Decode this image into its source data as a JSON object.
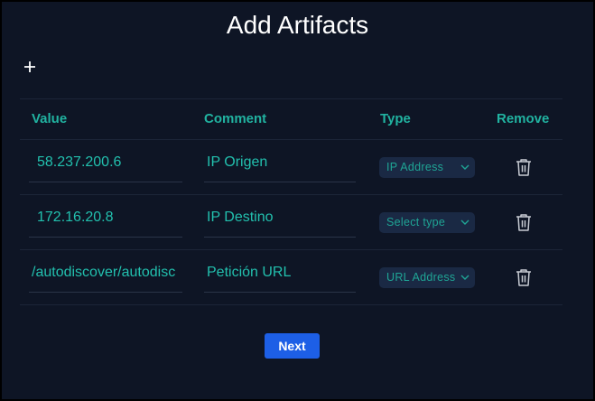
{
  "dialog": {
    "title": "Add Artifacts",
    "add_icon": "plus-icon",
    "next_label": "Next"
  },
  "table": {
    "headers": [
      "Value",
      "Comment",
      "Type",
      "Remove"
    ],
    "rows": [
      {
        "value": "58.237.200.6",
        "comment": "IP Origen",
        "type": "IP Address"
      },
      {
        "value": "172.16.20.8",
        "comment": "IP Destino",
        "type": "Select type"
      },
      {
        "value": "/autodiscover/autodisc",
        "comment": "Petición URL",
        "type": "URL Address"
      }
    ],
    "remove_icon": "trash-icon",
    "select_icon": "chevron-down-icon"
  },
  "colors": {
    "background": "#0e1525",
    "accent": "#21b3a1",
    "button": "#1d5fe6",
    "select_bg": "#1a2944"
  }
}
